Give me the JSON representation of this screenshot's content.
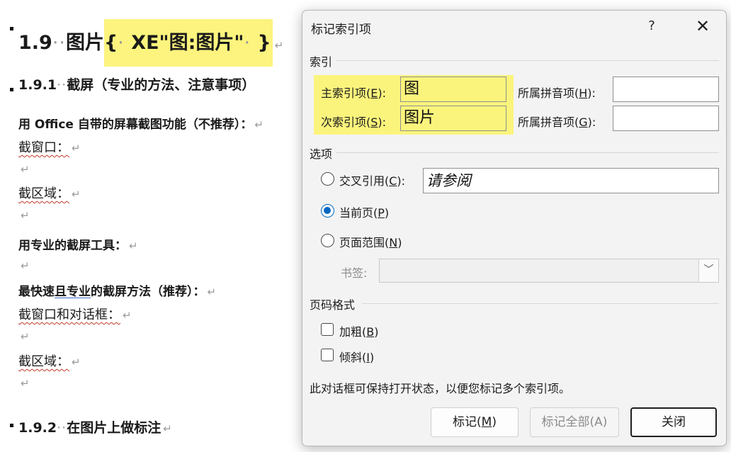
{
  "document": {
    "heading1": {
      "number": "1.9",
      "title": "图片",
      "field_open": "{",
      "field_code": "XE\"图:图片\"",
      "field_close": "}"
    },
    "heading2_1": {
      "number": "1.9.1",
      "title": "截屏（专业的方法、注意事项）"
    },
    "line_office": "用 Office 自带的屏幕截图功能（不推荐）：",
    "line_window1": "截窗口：",
    "line_region1": "截区域：",
    "line_pro_tools": "用专业的截屏工具：",
    "line_fastest": {
      "before": "最快速",
      "linked": "且专业",
      "after": "的截屏方法（推荐）："
    },
    "line_window_dialog": "截窗口和对话框：",
    "line_region2": "截区域：",
    "heading2_2": {
      "number": "1.9.2",
      "title": "在图片上做标注"
    },
    "paragraph_mark": "↵",
    "dots": "··"
  },
  "dialog": {
    "title": "标记索引项",
    "help": "?",
    "close": "✕",
    "index_section": "索引",
    "main_entry": {
      "label_before": "主索引项(",
      "key": "E",
      "label_after": "):",
      "value": "图"
    },
    "main_pinyin": {
      "label_before": "所属拼音项(",
      "key": "H",
      "label_after": "):",
      "value": ""
    },
    "sub_entry": {
      "label_before": "次索引项(",
      "key": "S",
      "label_after": "):",
      "value": "图片"
    },
    "sub_pinyin": {
      "label_before": "所属拼音项(",
      "key": "G",
      "label_after": "):",
      "value": ""
    },
    "options_section": "选项",
    "cross_ref": {
      "label_before": "交叉引用(",
      "key": "C",
      "label_after": "):",
      "value": "请参阅",
      "selected": false
    },
    "current_page": {
      "label_before": "当前页(",
      "key": "P",
      "label_after": ")",
      "selected": true
    },
    "page_range": {
      "label_before": "页面范围(",
      "key": "N",
      "label_after": ")",
      "selected": false
    },
    "bookmark": {
      "label": "书签:",
      "value": "",
      "arrow": "﹀"
    },
    "format_section": "页码格式",
    "bold": {
      "label_before": "加粗(",
      "key": "B",
      "label_after": ")",
      "checked": false
    },
    "italic": {
      "label_before": "倾斜(",
      "key": "I",
      "label_after": ")",
      "checked": false
    },
    "note": "此对话框可保持打开状态，以便您标记多个索引项。",
    "buttons": {
      "mark": {
        "label_before": "标记(",
        "key": "M",
        "label_after": ")"
      },
      "mark_all": "标记全部(A)",
      "close": "关闭"
    }
  },
  "colors": {
    "highlight": "#fbf47c",
    "accent": "#0067c0"
  }
}
